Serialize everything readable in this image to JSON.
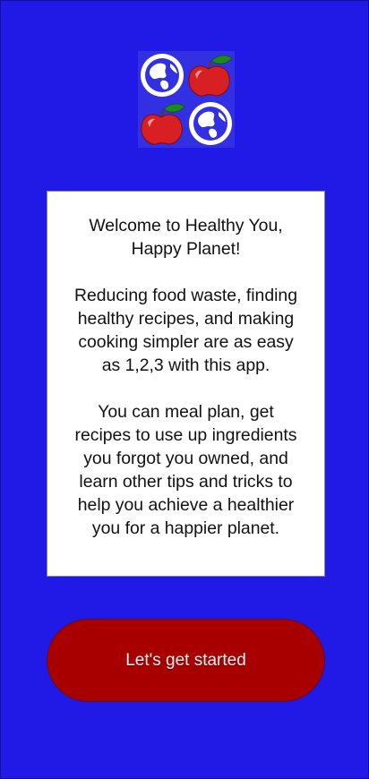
{
  "logo": {
    "icons": [
      "globe-icon",
      "apple-icon",
      "apple-icon",
      "globe-icon"
    ],
    "background_color": "#3330e4",
    "globe_color": "#ffffff",
    "apple_color": "#d81f24",
    "leaf_color": "#1d8a1d"
  },
  "welcome": {
    "title": "Welcome to Healthy You, Happy Planet!",
    "paragraph_1": "Reducing food waste, finding healthy recipes, and making cooking simpler are as easy as 1,2,3 with this app.",
    "paragraph_2": "You can meal plan, get recipes to use up ingredients you forgot you owned, and learn other tips and tricks to help you achieve a healthier you for a happier planet."
  },
  "start_button": {
    "label": "Let's get started"
  },
  "colors": {
    "screen_background": "#2119e6",
    "card_background": "#ffffff",
    "button_background": "#a80000",
    "button_text": "#f2f2f2"
  }
}
